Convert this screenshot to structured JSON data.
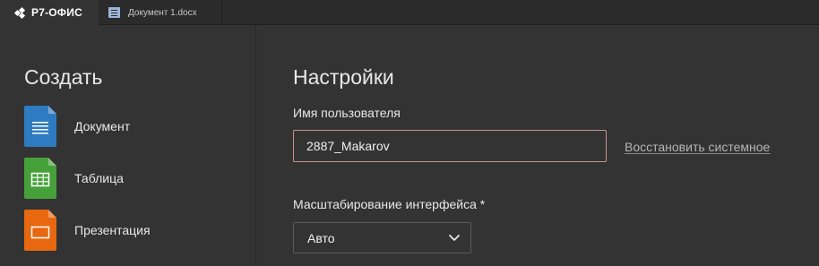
{
  "tabs": {
    "brand": "Р7-ОФИС",
    "document_tab": "Документ 1.docx"
  },
  "sidebar": {
    "title": "Создать",
    "items": [
      {
        "label": "Документ",
        "icon": "document-icon",
        "color": "#2f7bc1"
      },
      {
        "label": "Таблица",
        "icon": "spreadsheet-icon",
        "color": "#47a13b"
      },
      {
        "label": "Презентация",
        "icon": "presentation-icon",
        "color": "#e8680f"
      }
    ]
  },
  "settings": {
    "title": "Настройки",
    "username_label": "Имя пользователя",
    "username_value": "2887_Makarov",
    "restore_link": "Восстановить системное",
    "scale_label": "Масштабирование интерфейса *",
    "scale_value": "Авто"
  }
}
